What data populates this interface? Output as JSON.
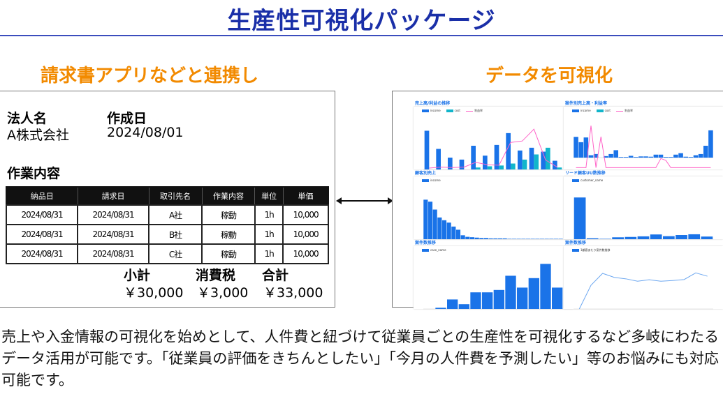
{
  "header": {
    "title": "生産性可視化パッケージ"
  },
  "sections": {
    "left_heading": "請求書アプリなどと連携し",
    "right_heading": "データを可視化"
  },
  "invoice": {
    "corp_label": "法人名",
    "corp_value": "A株式会社",
    "date_label": "作成日",
    "date_value": "2024/08/01",
    "work_label": "作業内容",
    "columns": [
      "納品日",
      "請求日",
      "取引先名",
      "作業内容",
      "単位",
      "単価"
    ],
    "rows": [
      [
        "2024/08/31",
        "2024/08/31",
        "A社",
        "稼動",
        "1h",
        "10,000"
      ],
      [
        "2024/08/31",
        "2024/08/31",
        "B社",
        "稼動",
        "1h",
        "10,000"
      ],
      [
        "2024/08/31",
        "2024/08/31",
        "C社",
        "稼動",
        "1h",
        "10,000"
      ]
    ],
    "subtotal_label": "小計",
    "subtotal_value": "￥30,000",
    "tax_label": "消費税",
    "tax_value": "￥3,000",
    "total_label": "合計",
    "total_value": "￥33,000"
  },
  "connector": {
    "icon": "double-arrow-icon"
  },
  "dashboard": {
    "colors": {
      "primary": "#1a73e8",
      "secondary": "#12b5cb",
      "line": "#ff63c8"
    },
    "panels": [
      {
        "title": "売上高/利益の推移",
        "legend": [
          "income",
          "cost",
          "利益率"
        ]
      },
      {
        "title": "案件別売上高・利益率",
        "legend": [
          "income",
          "cost",
          "利益率"
        ]
      },
      {
        "title": "顧客別売上",
        "legend": [
          "income"
        ]
      },
      {
        "title": "リード顧客UU数推移",
        "legend": [
          "customer_name"
        ]
      },
      {
        "title": "案件数推移",
        "legend": [
          "case_name"
        ]
      },
      {
        "title": "案件数推移",
        "legend": [
          "1顧客あたり案件数推移"
        ]
      }
    ]
  },
  "chart_data": [
    {
      "type": "bar",
      "title": "売上高/利益の推移",
      "series": [
        {
          "name": "income",
          "values": [
            98,
            52,
            30,
            25,
            60,
            35,
            62,
            92,
            48,
            55,
            45,
            22
          ]
        },
        {
          "name": "cost",
          "values": [
            0,
            0,
            0,
            0,
            5,
            8,
            10,
            15,
            25,
            38,
            55,
            5
          ]
        },
        {
          "name": "利益率",
          "values": [
            3,
            5,
            4,
            5,
            15,
            10,
            9,
            57,
            60,
            85,
            20,
            5
          ]
        }
      ],
      "ylim": [
        0,
        120
      ]
    },
    {
      "type": "bar",
      "title": "案件別売上高・利益率",
      "series": [
        {
          "name": "income",
          "values": [
            70,
            52,
            68,
            8,
            12,
            0,
            5,
            12,
            25,
            2,
            2,
            6,
            2,
            4,
            4,
            3,
            10,
            10,
            2,
            2,
            10,
            15,
            3,
            2,
            8,
            12,
            40,
            92
          ]
        },
        {
          "name": "利益率",
          "values": [
            5,
            5,
            5,
            120,
            5,
            90,
            5,
            5,
            5,
            5,
            5,
            5,
            5,
            5,
            5,
            5,
            5,
            30,
            25,
            5,
            5,
            5,
            5,
            5,
            5,
            5,
            5,
            5
          ]
        }
      ],
      "ylim": [
        -40,
        120
      ]
    },
    {
      "type": "bar",
      "title": "顧客別売上",
      "series": [
        {
          "name": "income",
          "values": [
            100,
            95,
            75,
            55,
            48,
            42,
            32,
            24,
            10,
            6,
            5,
            4,
            3,
            3,
            2,
            2,
            2,
            2,
            1,
            1,
            1,
            1,
            1,
            1,
            1,
            1,
            1,
            1,
            1,
            1
          ]
        }
      ],
      "ylim": [
        0,
        120
      ]
    },
    {
      "type": "bar",
      "title": "リード顧客UU数推移",
      "series": [
        {
          "name": "customer_name",
          "values": [
            22,
            0.5,
            0.2,
            1,
            1.2,
            1.5,
            2.5,
            1.6,
            2.2,
            2.6,
            1.4
          ]
        }
      ],
      "ylim": [
        0,
        25
      ]
    },
    {
      "type": "bar",
      "title": "案件数推移",
      "series": [
        {
          "name": "case_name",
          "values": [
            0,
            1,
            8,
            4,
            14,
            14,
            16,
            28,
            18,
            26,
            38,
            18
          ]
        }
      ],
      "ylim": [
        0,
        40
      ]
    },
    {
      "type": "line",
      "title": "案件数推移",
      "series": [
        {
          "name": "1顧客あたり案件数推移",
          "values": [
            0,
            1,
            1.5,
            1.33,
            1.27,
            1.17,
            1.23,
            1.17,
            1.2,
            1.24,
            1.52,
            1.38
          ]
        }
      ],
      "ylim": [
        0,
        2
      ]
    }
  ],
  "description": "売上や入金情報の可視化を始めとして、人件費と紐づけて従業員ごとの生産性を可視化するなど多岐にわたるデータ活用が可能です。「従業員の評価をきちんとしたい」「今月の人件費を予測したい」等のお悩みにも対応可能です。"
}
